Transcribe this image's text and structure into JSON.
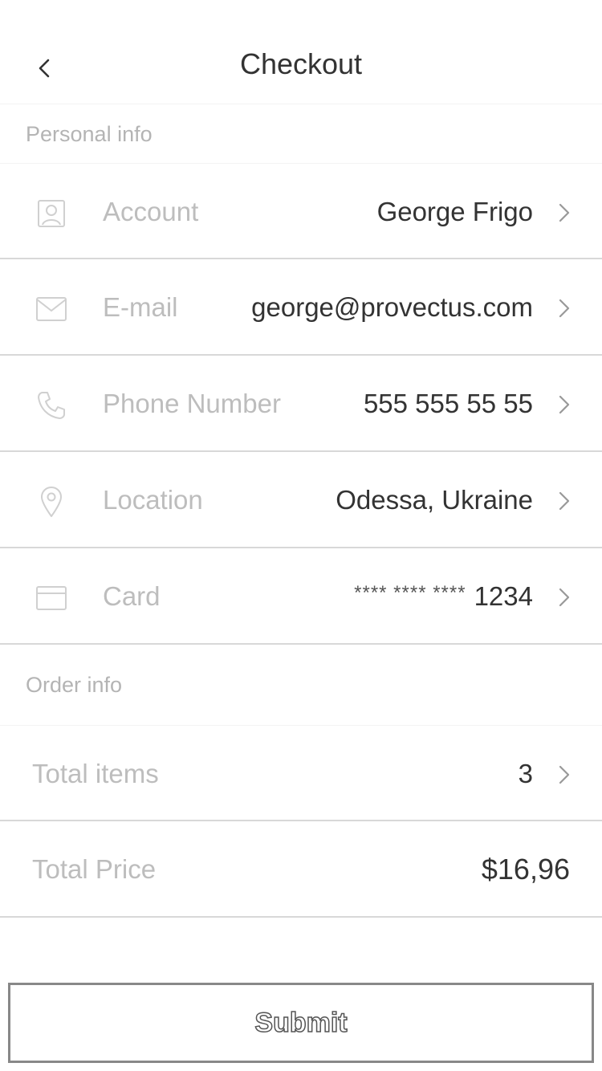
{
  "header": {
    "title": "Checkout"
  },
  "personal_info": {
    "section_label": "Personal info",
    "rows": [
      {
        "icon": "user-icon",
        "label": "Account",
        "value": "George Frigo"
      },
      {
        "icon": "mail-icon",
        "label": "E-mail",
        "value": "george@provectus.com"
      },
      {
        "icon": "phone-icon",
        "label": "Phone Number",
        "value": "555 555 55 55"
      },
      {
        "icon": "location-pin-icon",
        "label": "Location",
        "value": "Odessa, Ukraine"
      },
      {
        "icon": "credit-card-icon",
        "label": "Card",
        "value_mask": "**** **** ****",
        "value": "1234"
      }
    ]
  },
  "order_info": {
    "section_label": "Order info",
    "total_items": {
      "label": "Total items",
      "value": "3"
    },
    "total_price": {
      "label": "Total Price",
      "value": "$16,96"
    }
  },
  "submit": {
    "label": "Submit"
  },
  "colors": {
    "label_gray": "#bdbdbd",
    "value_dark": "#333333",
    "divider": "#d8d8d8",
    "icon_gray": "#d0d0d0",
    "button_border": "#888888"
  }
}
